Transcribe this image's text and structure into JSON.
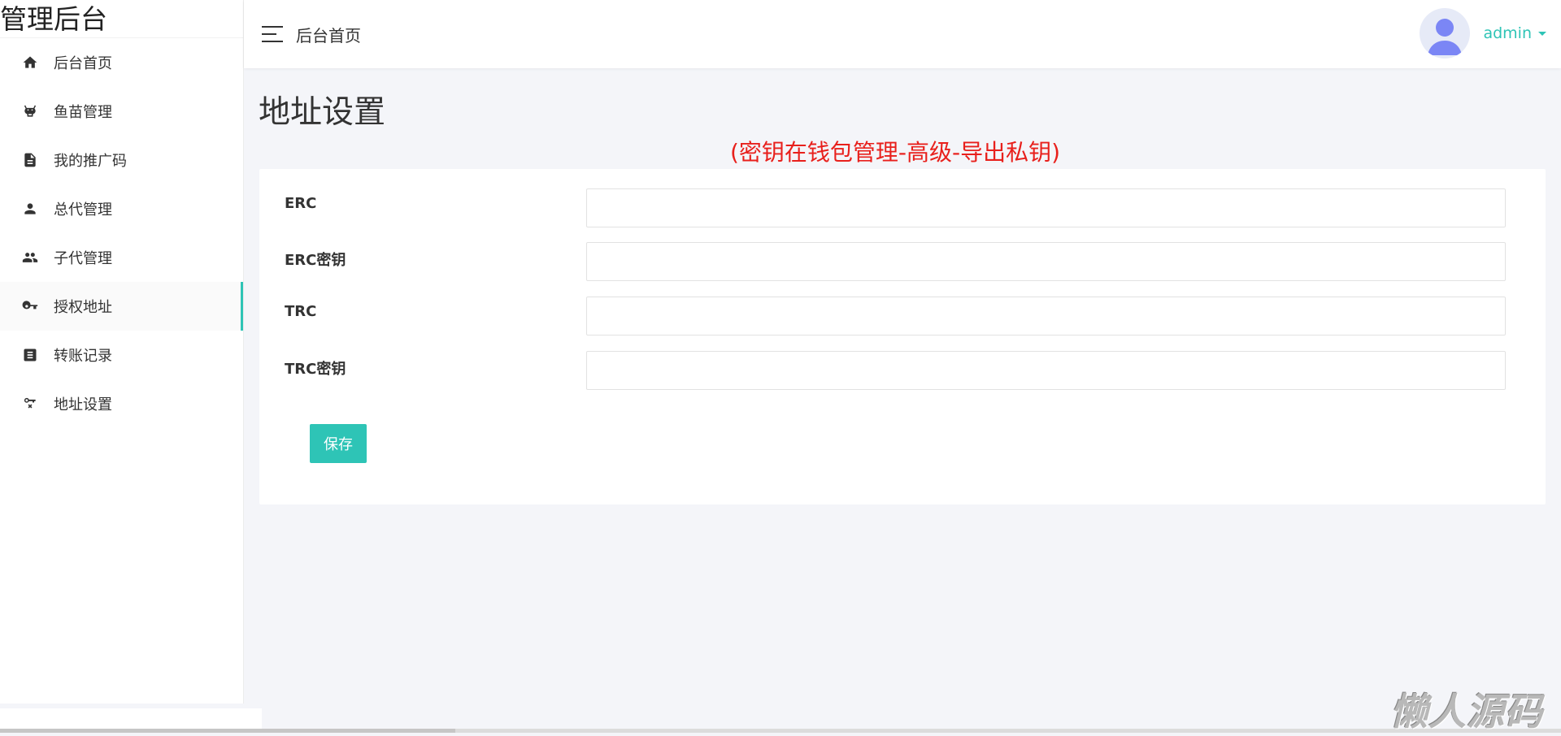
{
  "app": {
    "brand": "管理后台"
  },
  "sidebar": {
    "items": [
      {
        "label": "后台首页",
        "icon": "home-icon"
      },
      {
        "label": "鱼苗管理",
        "icon": "cow-icon"
      },
      {
        "label": "我的推广码",
        "icon": "document-icon"
      },
      {
        "label": "总代管理",
        "icon": "person-icon"
      },
      {
        "label": "子代管理",
        "icon": "people-icon"
      },
      {
        "label": "授权地址",
        "icon": "key-icon",
        "active": true
      },
      {
        "label": "转账记录",
        "icon": "receipt-icon"
      },
      {
        "label": "地址设置",
        "icon": "key-remove-icon"
      }
    ]
  },
  "header": {
    "title": "后台首页",
    "username": "admin"
  },
  "main": {
    "page_title": "地址设置",
    "notice": "(密钥在钱包管理-高级-导出私钥)",
    "form": {
      "fields": [
        {
          "label": "ERC",
          "value": "",
          "placeholder": ""
        },
        {
          "label": "ERC密钥",
          "value": "",
          "placeholder": ""
        },
        {
          "label": "TRC",
          "value": "",
          "placeholder": ""
        },
        {
          "label": "TRC密钥",
          "value": "",
          "placeholder": ""
        }
      ],
      "save_label": "保存"
    }
  },
  "watermark": "懒人源码",
  "colors": {
    "accent": "#2ec4b6",
    "notice": "#e8201c",
    "background": "#f4f5f9"
  }
}
